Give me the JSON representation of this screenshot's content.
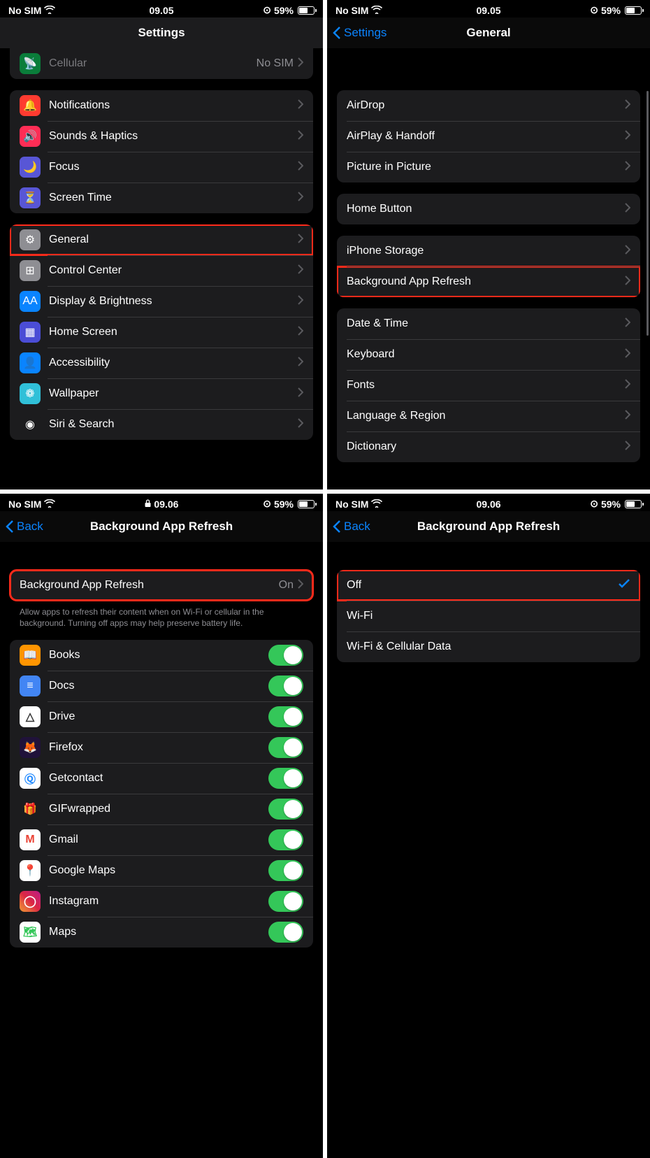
{
  "status": {
    "carrier": "No SIM",
    "time1": "09.05",
    "time2": "09.06",
    "battery": "59%"
  },
  "p1": {
    "title": "Settings",
    "cellular": {
      "label": "Cellular",
      "value": "No SIM"
    },
    "g1": [
      {
        "label": "Notifications",
        "ic": "🔔",
        "bg": "#ff3b30"
      },
      {
        "label": "Sounds & Haptics",
        "ic": "🔊",
        "bg": "#ff2d55"
      },
      {
        "label": "Focus",
        "ic": "🌙",
        "bg": "#5856d6"
      },
      {
        "label": "Screen Time",
        "ic": "⏳",
        "bg": "#5856d6"
      }
    ],
    "g2": [
      {
        "label": "General",
        "ic": "⚙",
        "bg": "#8e8e93",
        "hi": true
      },
      {
        "label": "Control Center",
        "ic": "⊞",
        "bg": "#8e8e93"
      },
      {
        "label": "Display & Brightness",
        "ic": "AA",
        "bg": "#0a84ff"
      },
      {
        "label": "Home Screen",
        "ic": "▦",
        "bg": "#4b4dd6"
      },
      {
        "label": "Accessibility",
        "ic": "👤",
        "bg": "#0a84ff"
      },
      {
        "label": "Wallpaper",
        "ic": "❁",
        "bg": "#30c0d8"
      },
      {
        "label": "Siri & Search",
        "ic": "◉",
        "bg": "#1c1c1e"
      }
    ]
  },
  "p2": {
    "back": "Settings",
    "title": "General",
    "g1": [
      "AirDrop",
      "AirPlay & Handoff",
      "Picture in Picture"
    ],
    "g2": [
      "Home Button"
    ],
    "g3": [
      {
        "label": "iPhone Storage"
      },
      {
        "label": "Background App Refresh",
        "hi": true
      }
    ],
    "g4": [
      "Date & Time",
      "Keyboard",
      "Fonts",
      "Language & Region",
      "Dictionary"
    ]
  },
  "p3": {
    "back": "Back",
    "title": "Background App Refresh",
    "main": {
      "label": "Background App Refresh",
      "value": "On",
      "hi": true
    },
    "caption": "Allow apps to refresh their content when on Wi-Fi or cellular in the background. Turning off apps may help preserve battery life.",
    "apps": [
      {
        "label": "Books",
        "bg": "#ff9500",
        "fg": "#fff",
        "ic": "📖"
      },
      {
        "label": "Docs",
        "bg": "#4285f4",
        "fg": "#fff",
        "ic": "≡"
      },
      {
        "label": "Drive",
        "bg": "#fff",
        "fg": "#333",
        "ic": "△"
      },
      {
        "label": "Firefox",
        "bg": "#20123a",
        "fg": "#ff9500",
        "ic": "🦊"
      },
      {
        "label": "Getcontact",
        "bg": "#fff",
        "fg": "#1e88ff",
        "ic": "Ⓠ"
      },
      {
        "label": "GIFwrapped",
        "bg": "#1c1c1e",
        "fg": "#ffeb3b",
        "ic": "🎁"
      },
      {
        "label": "Gmail",
        "bg": "#fff",
        "fg": "#ea4335",
        "ic": "M"
      },
      {
        "label": "Google Maps",
        "bg": "#fff",
        "fg": "#34a853",
        "ic": "📍"
      },
      {
        "label": "Instagram",
        "bg": "linear-gradient(45deg,#f09433,#e6683c,#dc2743,#cc2366,#bc1888)",
        "fg": "#fff",
        "ic": "◯"
      },
      {
        "label": "Maps",
        "bg": "#fff",
        "fg": "#34c759",
        "ic": "🗺"
      }
    ]
  },
  "p4": {
    "back": "Back",
    "title": "Background App Refresh",
    "options": [
      {
        "label": "Off",
        "sel": true,
        "hi": true
      },
      {
        "label": "Wi-Fi"
      },
      {
        "label": "Wi-Fi & Cellular Data"
      }
    ]
  }
}
